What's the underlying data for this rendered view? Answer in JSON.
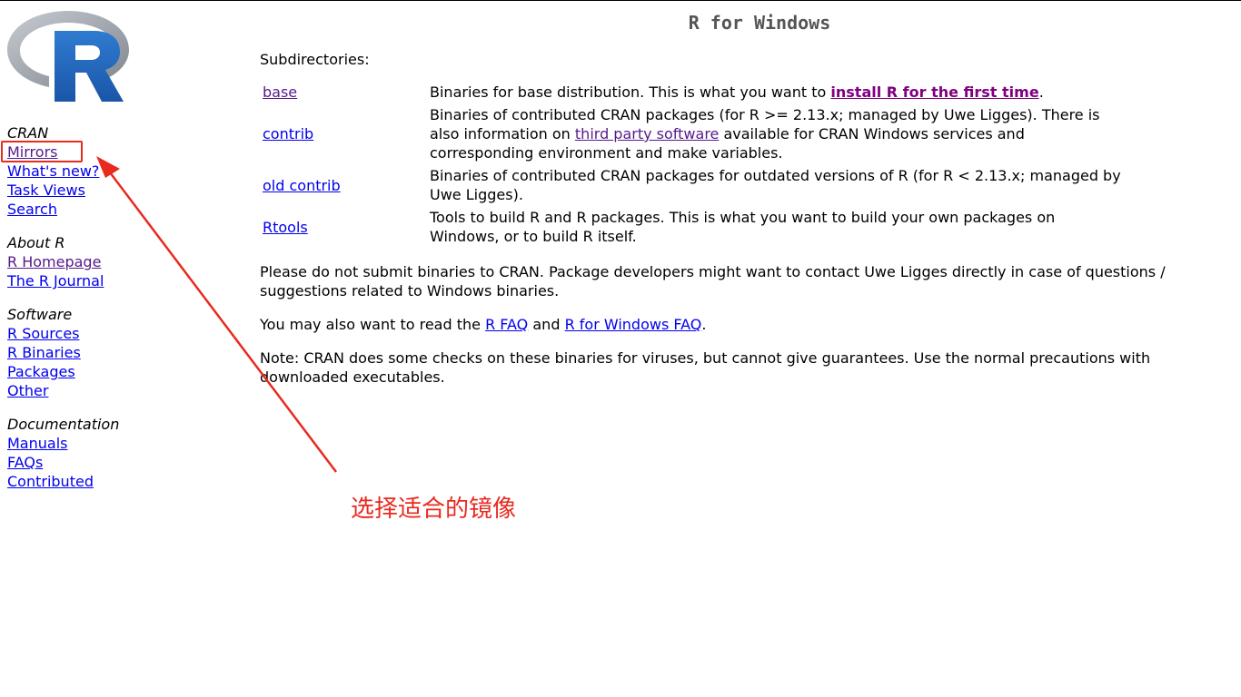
{
  "page": {
    "title": "R for Windows"
  },
  "colors": {
    "link": "#0000ee",
    "visited": "#551a8b",
    "annotation": "#e82a1f",
    "logo_blue": "#1f62b4",
    "logo_gray": "#9aa0a8"
  },
  "sidebar": {
    "logo": {
      "letter": "R",
      "icon": "r-logo-icon"
    },
    "groups": [
      {
        "heading": "CRAN",
        "links": [
          "Mirrors",
          "What's new?",
          "Task Views",
          "Search"
        ]
      },
      {
        "heading": "About R",
        "links": [
          "R Homepage",
          "The R Journal"
        ]
      },
      {
        "heading": "Software",
        "links": [
          "R Sources",
          "R Binaries",
          "Packages",
          "Other"
        ]
      },
      {
        "heading": "Documentation",
        "links": [
          "Manuals",
          "FAQs",
          "Contributed"
        ]
      }
    ]
  },
  "main": {
    "subdirectories_label": "Subdirectories:",
    "rows": [
      {
        "name": "base",
        "desc_pre": "Binaries for base distribution. This is what you want to ",
        "desc_link": "install R for the first time",
        "desc_post": "."
      },
      {
        "name": "contrib",
        "desc_pre": "Binaries of contributed CRAN packages (for R >= 2.13.x; managed by Uwe Ligges). There is also information on ",
        "desc_link": "third party software",
        "desc_post": " available for CRAN Windows services and corresponding environment and make variables."
      },
      {
        "name": "old contrib",
        "desc": "Binaries of contributed CRAN packages for outdated versions of R (for R < 2.13.x; managed by Uwe Ligges)."
      },
      {
        "name": "Rtools",
        "desc": "Tools to build R and R packages. This is what you want to build your own packages on Windows, or to build R itself."
      }
    ],
    "para_submit": "Please do not submit binaries to CRAN. Package developers might want to contact Uwe Ligges directly in case of questions / suggestions related to Windows binaries.",
    "para_read_pre": "You may also want to read the ",
    "para_read_link1": "R FAQ",
    "para_read_mid": " and ",
    "para_read_link2": "R for Windows FAQ",
    "para_read_post": ".",
    "para_note": "Note: CRAN does some checks on these binaries for viruses, but cannot give guarantees. Use the normal precautions with downloaded executables."
  },
  "annotation": {
    "text": "选择适合的镜像"
  }
}
